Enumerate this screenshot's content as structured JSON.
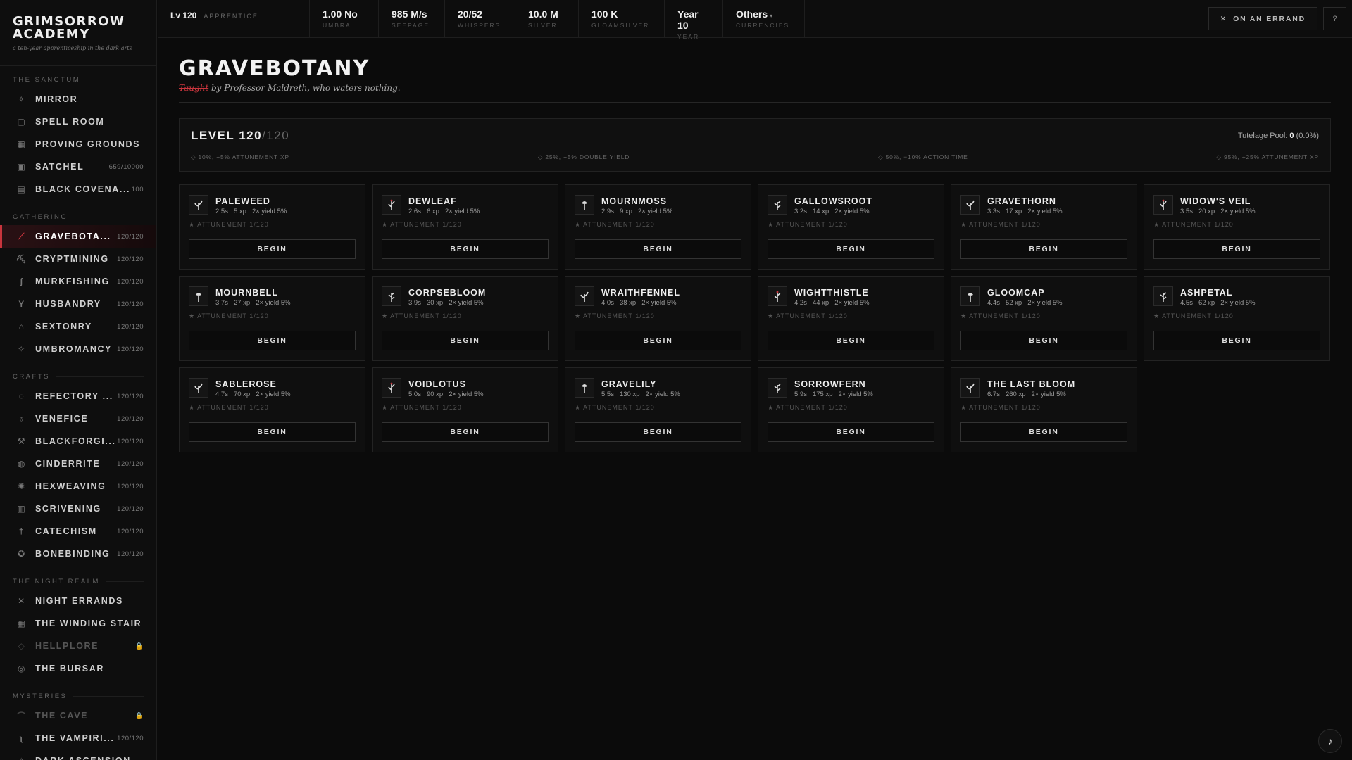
{
  "app": {
    "title_line1": "GRIMSORROW",
    "title_line2": "ACADEMY",
    "subtitle": "a ten-year apprenticeship in the dark arts"
  },
  "sidebar": {
    "sections": [
      {
        "label": "THE SANCTUM",
        "items": [
          {
            "label": "MIRROR",
            "icon": "mirror-icon",
            "glyph": "✧",
            "count": ""
          },
          {
            "label": "SPELL ROOM",
            "icon": "spell-room-icon",
            "glyph": "▢",
            "count": ""
          },
          {
            "label": "PROVING GROUNDS",
            "icon": "proving-grounds-icon",
            "glyph": "▦",
            "count": ""
          },
          {
            "label": "SATCHEL",
            "icon": "satchel-icon",
            "glyph": "▣",
            "count": "659/10000"
          },
          {
            "label": "BLACK COVENA...",
            "icon": "black-covenant-icon",
            "glyph": "▤",
            "count": "100"
          }
        ]
      },
      {
        "label": "GATHERING",
        "items": [
          {
            "label": "GRAVEBOTA...",
            "icon": "gravebotany-icon",
            "glyph": "⟋",
            "count": "120/120",
            "active": true
          },
          {
            "label": "CRYPTMINING",
            "icon": "cryptmining-icon",
            "glyph": "⛏",
            "count": "120/120"
          },
          {
            "label": "MURKFISHING",
            "icon": "murkfishing-icon",
            "glyph": "ʃ",
            "count": "120/120"
          },
          {
            "label": "HUSBANDRY",
            "icon": "husbandry-icon",
            "glyph": "Y",
            "count": "120/120"
          },
          {
            "label": "SEXTONRY",
            "icon": "sextonry-icon",
            "glyph": "⌂",
            "count": "120/120"
          },
          {
            "label": "UMBROMANCY",
            "icon": "umbromancy-icon",
            "glyph": "✧",
            "count": "120/120"
          }
        ]
      },
      {
        "label": "CRAFTS",
        "items": [
          {
            "label": "REFECTORY ...",
            "icon": "refectory-icon",
            "glyph": "◌",
            "count": "120/120"
          },
          {
            "label": "VENEFICE",
            "icon": "venefice-icon",
            "glyph": "♁",
            "count": "120/120"
          },
          {
            "label": "BLACKFORGI...",
            "icon": "blackforging-icon",
            "glyph": "⚒",
            "count": "120/120"
          },
          {
            "label": "CINDERRITE",
            "icon": "cinderrite-icon",
            "glyph": "◍",
            "count": "120/120"
          },
          {
            "label": "HEXWEAVING",
            "icon": "hexweaving-icon",
            "glyph": "✺",
            "count": "120/120"
          },
          {
            "label": "SCRIVENING",
            "icon": "scrivening-icon",
            "glyph": "▥",
            "count": "120/120"
          },
          {
            "label": "CATECHISM",
            "icon": "catechism-icon",
            "glyph": "†",
            "count": "120/120"
          },
          {
            "label": "BONEBINDING",
            "icon": "bonebinding-icon",
            "glyph": "✪",
            "count": "120/120"
          }
        ]
      },
      {
        "label": "THE NIGHT REALM",
        "items": [
          {
            "label": "NIGHT ERRANDS",
            "icon": "night-errands-icon",
            "glyph": "✕",
            "count": ""
          },
          {
            "label": "THE WINDING STAIR",
            "icon": "winding-stair-icon",
            "glyph": "▦",
            "count": ""
          },
          {
            "label": "HELLPLORE",
            "icon": "hellplore-icon",
            "glyph": "◇",
            "count": "🔒",
            "locked": true
          },
          {
            "label": "THE BURSAR",
            "icon": "bursar-icon",
            "glyph": "◎",
            "count": ""
          }
        ]
      },
      {
        "label": "MYSTERIES",
        "items": [
          {
            "label": "THE CAVE",
            "icon": "cave-icon",
            "glyph": "⌒",
            "count": "🔒",
            "locked": true
          },
          {
            "label": "THE VAMPIRI...",
            "icon": "vampiric-icon",
            "glyph": "ʅ",
            "count": "120/120"
          },
          {
            "label": "DARK ASCENSION",
            "icon": "dark-ascension-icon",
            "glyph": "✧",
            "count": ""
          }
        ]
      }
    ]
  },
  "topbar": {
    "level": {
      "value": "Lv 120",
      "label": "APPRENTICE"
    },
    "stats": [
      {
        "value": "1.00 No",
        "label": "UMBRA"
      },
      {
        "value": "985 M/s",
        "label": "SEEPAGE"
      },
      {
        "value": "20/52",
        "label": "WHISPERS"
      },
      {
        "value": "10.0 M",
        "label": "SILVER"
      },
      {
        "value": "100 K",
        "label": "GLOAMSILVER"
      },
      {
        "value": "Year 10",
        "label": "YEAR"
      },
      {
        "value": "Others",
        "label": "CURRENCIES",
        "caret": "▾"
      }
    ],
    "errand_button": "ON AN ERRAND",
    "help_button": "?"
  },
  "main": {
    "title": "GRAVEBOTANY",
    "subtitle_strike": "Taught",
    "subtitle_rest": " by Professor Maldreth, who waters nothing.",
    "level_label": "LEVEL 120",
    "level_max": "/120",
    "pool_label": "Tutelage Pool:",
    "pool_value": "0",
    "pool_pct": "(0.0%)",
    "milestones": [
      "◇ 10%, +5% ATTUNEMENT XP",
      "◇ 25%, +5% DOUBLE YIELD",
      "◇ 50%, −10% ACTION TIME",
      "◇ 95%, +25% ATTUNEMENT XP"
    ],
    "begin_label": "BEGIN",
    "plants": [
      {
        "name": "PALEWEED",
        "time": "2.5s",
        "xp": "5 xp",
        "yield": "2× yield 5%",
        "attune": "ATTUNEMENT 1/120"
      },
      {
        "name": "DEWLEAF",
        "time": "2.6s",
        "xp": "6 xp",
        "yield": "2× yield 5%",
        "attune": "ATTUNEMENT 1/120"
      },
      {
        "name": "MOURNMOSS",
        "time": "2.9s",
        "xp": "9 xp",
        "yield": "2× yield 5%",
        "attune": "ATTUNEMENT 1/120"
      },
      {
        "name": "GALLOWSROOT",
        "time": "3.2s",
        "xp": "14 xp",
        "yield": "2× yield 5%",
        "attune": "ATTUNEMENT 1/120"
      },
      {
        "name": "GRAVETHORN",
        "time": "3.3s",
        "xp": "17 xp",
        "yield": "2× yield 5%",
        "attune": "ATTUNEMENT 1/120"
      },
      {
        "name": "WIDOW'S VEIL",
        "time": "3.5s",
        "xp": "20 xp",
        "yield": "2× yield 5%",
        "attune": "ATTUNEMENT 1/120"
      },
      {
        "name": "MOURNBELL",
        "time": "3.7s",
        "xp": "27 xp",
        "yield": "2× yield 5%",
        "attune": "ATTUNEMENT 1/120"
      },
      {
        "name": "CORPSEBLOOM",
        "time": "3.9s",
        "xp": "30 xp",
        "yield": "2× yield 5%",
        "attune": "ATTUNEMENT 1/120"
      },
      {
        "name": "WRAITHFENNEL",
        "time": "4.0s",
        "xp": "38 xp",
        "yield": "2× yield 5%",
        "attune": "ATTUNEMENT 1/120"
      },
      {
        "name": "WIGHTTHISTLE",
        "time": "4.2s",
        "xp": "44 xp",
        "yield": "2× yield 5%",
        "attune": "ATTUNEMENT 1/120"
      },
      {
        "name": "GLOOMCAP",
        "time": "4.4s",
        "xp": "52 xp",
        "yield": "2× yield 5%",
        "attune": "ATTUNEMENT 1/120"
      },
      {
        "name": "ASHPETAL",
        "time": "4.5s",
        "xp": "62 xp",
        "yield": "2× yield 5%",
        "attune": "ATTUNEMENT 1/120"
      },
      {
        "name": "SABLEROSE",
        "time": "4.7s",
        "xp": "70 xp",
        "yield": "2× yield 5%",
        "attune": "ATTUNEMENT 1/120"
      },
      {
        "name": "VOIDLOTUS",
        "time": "5.0s",
        "xp": "90 xp",
        "yield": "2× yield 5%",
        "attune": "ATTUNEMENT 1/120"
      },
      {
        "name": "GRAVELILY",
        "time": "5.5s",
        "xp": "130 xp",
        "yield": "2× yield 5%",
        "attune": "ATTUNEMENT 1/120"
      },
      {
        "name": "SORROWFERN",
        "time": "5.9s",
        "xp": "175 xp",
        "yield": "2× yield 5%",
        "attune": "ATTUNEMENT 1/120"
      },
      {
        "name": "THE LAST BLOOM",
        "time": "6.7s",
        "xp": "260 xp",
        "yield": "2× yield 5%",
        "attune": "ATTUNEMENT 1/120"
      }
    ]
  },
  "music_button": "♪",
  "colors": {
    "accent": "#c8353d",
    "background": "#0b0b0b",
    "panel": "#0f0f0f"
  }
}
